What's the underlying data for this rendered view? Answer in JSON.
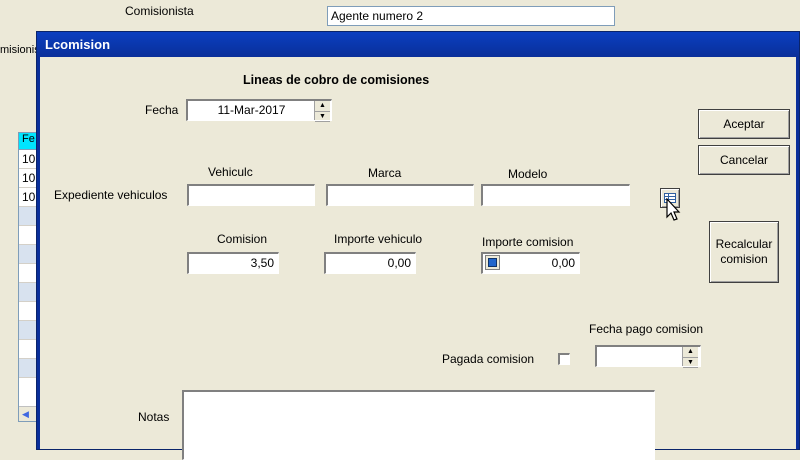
{
  "background": {
    "comisionista_label": "Comisionista",
    "comisionista_value": "Agente numero 2",
    "side_label": "misionis",
    "grid_header": "Fe",
    "grid_rows": [
      "10",
      "10",
      "10"
    ]
  },
  "dialog": {
    "title": "Lcomision",
    "heading": "Lineas de cobro de comisiones",
    "fecha_label": "Fecha",
    "fecha_value": "11-Mar-2017",
    "expediente_label": "Expediente vehiculos",
    "vehiculo_label": "Vehiculc",
    "marca_label": "Marca",
    "modelo_label": "Modelo",
    "vehiculo_value": "",
    "marca_value": "",
    "modelo_value": "",
    "comision_label": "Comision",
    "comision_value": "3,50",
    "importe_vehiculo_label": "Importe vehiculo",
    "importe_vehiculo_value": "0,00",
    "importe_comision_label": "Importe comision",
    "importe_comision_value": "0,00",
    "fecha_pago_label": "Fecha pago comision",
    "fecha_pago_value": "",
    "pagada_label": "Pagada comision",
    "pagada_checked": false,
    "notas_label": "Notas",
    "notas_value": "",
    "buttons": {
      "aceptar": "Aceptar",
      "cancelar": "Cancelar",
      "recalcular": "Recalcular comision"
    }
  }
}
